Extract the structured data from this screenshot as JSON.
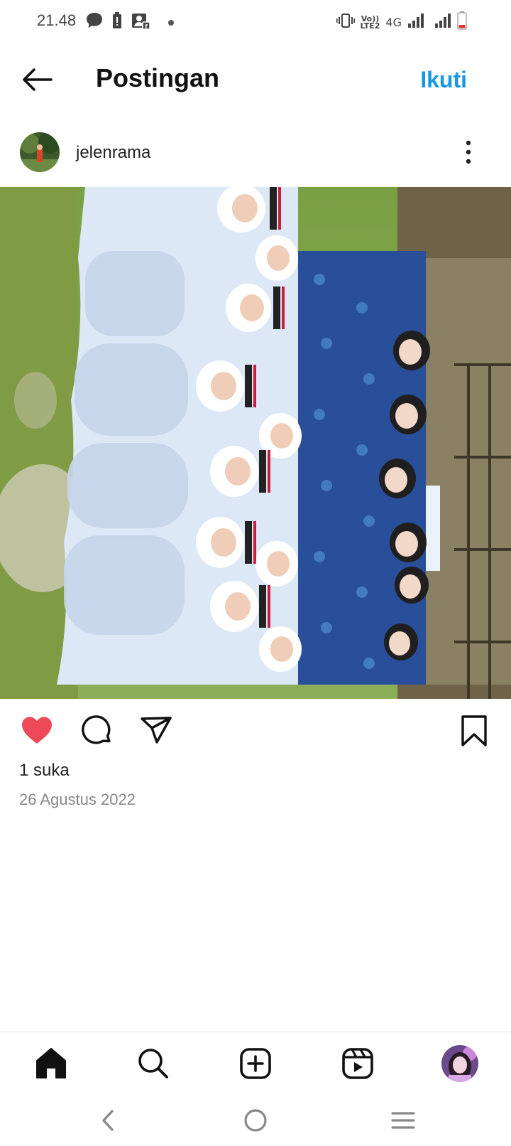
{
  "status_bar": {
    "time": "21.48",
    "volte_top": "Vo))",
    "volte_bottom": "LTE2",
    "network": "4G",
    "icons": [
      "message-icon",
      "battery-alert-icon",
      "account-notification-icon",
      "dot-icon",
      "vibrate-icon",
      "signal-icon",
      "battery-low-icon"
    ]
  },
  "header": {
    "title": "Postingan",
    "follow_label": "Ikuti",
    "back_icon": "arrow-left-icon"
  },
  "post": {
    "username": "jelenrama",
    "more_icon": "more-vertical-icon",
    "image_alt": "group photo",
    "likes_text": "1 suka",
    "date_text": "26 Agustus 2022",
    "liked": true
  },
  "actions": {
    "icons": [
      "heart-icon",
      "comment-icon",
      "share-icon",
      "bookmark-icon"
    ]
  },
  "bottom_nav": {
    "icons": [
      "home-icon",
      "search-icon",
      "add-post-icon",
      "reels-icon",
      "profile-avatar"
    ]
  },
  "system_nav": {
    "icons": [
      "back-chevron-icon",
      "home-circle-icon",
      "recents-menu-icon"
    ]
  },
  "colors": {
    "accent": "#1597e5",
    "like_red": "#ed4956",
    "muted_text": "#888888"
  }
}
